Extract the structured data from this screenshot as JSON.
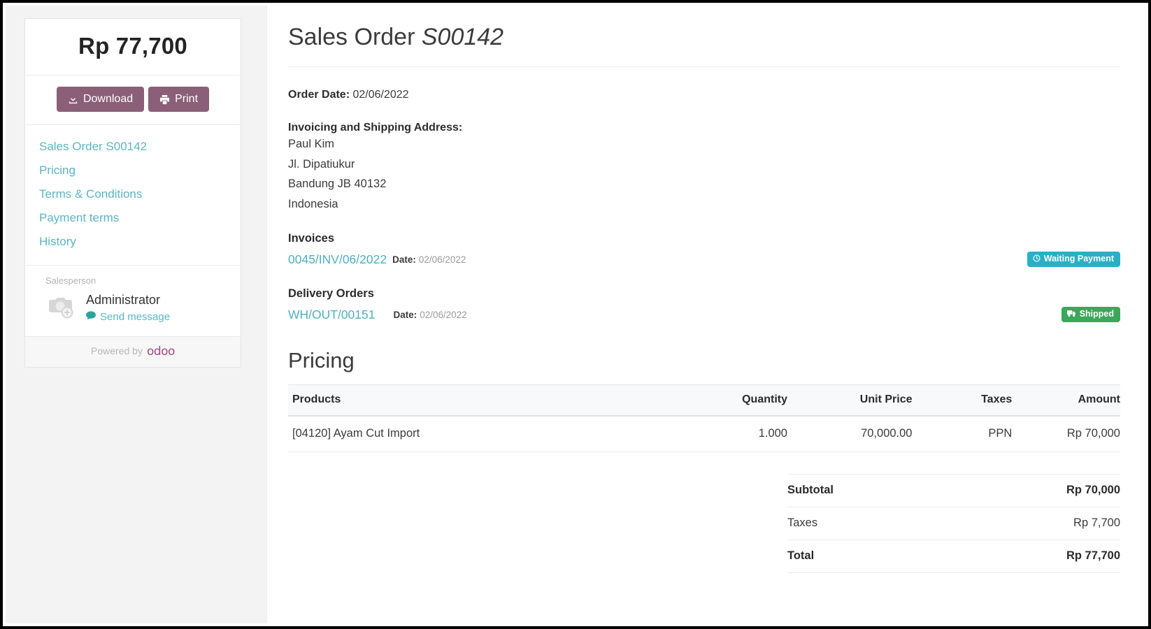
{
  "sidebar": {
    "amount_total": "Rp 77,700",
    "download_label": "Download",
    "print_label": "Print",
    "nav_items": [
      {
        "label": "Sales Order S00142"
      },
      {
        "label": "Pricing"
      },
      {
        "label": "Terms & Conditions"
      },
      {
        "label": "Payment terms"
      },
      {
        "label": "History"
      }
    ],
    "salesperson_label": "Salesperson",
    "salesperson_name": "Administrator",
    "send_message_label": "Send message",
    "powered_by": "Powered by",
    "powered_brand": "odoo"
  },
  "main": {
    "title_prefix": "Sales Order",
    "title_reference": "S00142",
    "order_date_label": "Order Date:",
    "order_date_value": "02/06/2022",
    "address_title": "Invoicing and Shipping Address:",
    "address_lines": [
      "Paul Kim",
      "Jl. Dipatiukur",
      "Bandung JB 40132",
      "Indonesia"
    ],
    "invoices": {
      "heading": "Invoices",
      "reference": "0045/INV/06/2022",
      "date_label": "Date:",
      "date_value": "02/06/2022",
      "status": "Waiting Payment",
      "status_color": "#29b0c6"
    },
    "deliveries": {
      "heading": "Delivery Orders",
      "reference": "WH/OUT/00151",
      "date_label": "Date:",
      "date_value": "02/06/2022",
      "status": "Shipped",
      "status_color": "#3aa75b"
    },
    "pricing": {
      "heading": "Pricing",
      "columns": [
        "Products",
        "Quantity",
        "Unit Price",
        "Taxes",
        "Amount"
      ],
      "rows": [
        {
          "product": "[04120] Ayam Cut Import",
          "quantity": "1.000",
          "unit_price": "70,000.00",
          "taxes": "PPN",
          "amount": "Rp 70,000"
        }
      ],
      "totals": [
        {
          "label": "Subtotal",
          "value": "Rp 70,000",
          "strong": true
        },
        {
          "label": "Taxes",
          "value": "Rp 7,700",
          "strong": false
        },
        {
          "label": "Total",
          "value": "Rp 77,700",
          "strong": true
        }
      ]
    }
  },
  "colors": {
    "brand_purple": "#8b5f78",
    "link_teal": "#5bb6c4",
    "odoo_purple": "#a24689"
  }
}
